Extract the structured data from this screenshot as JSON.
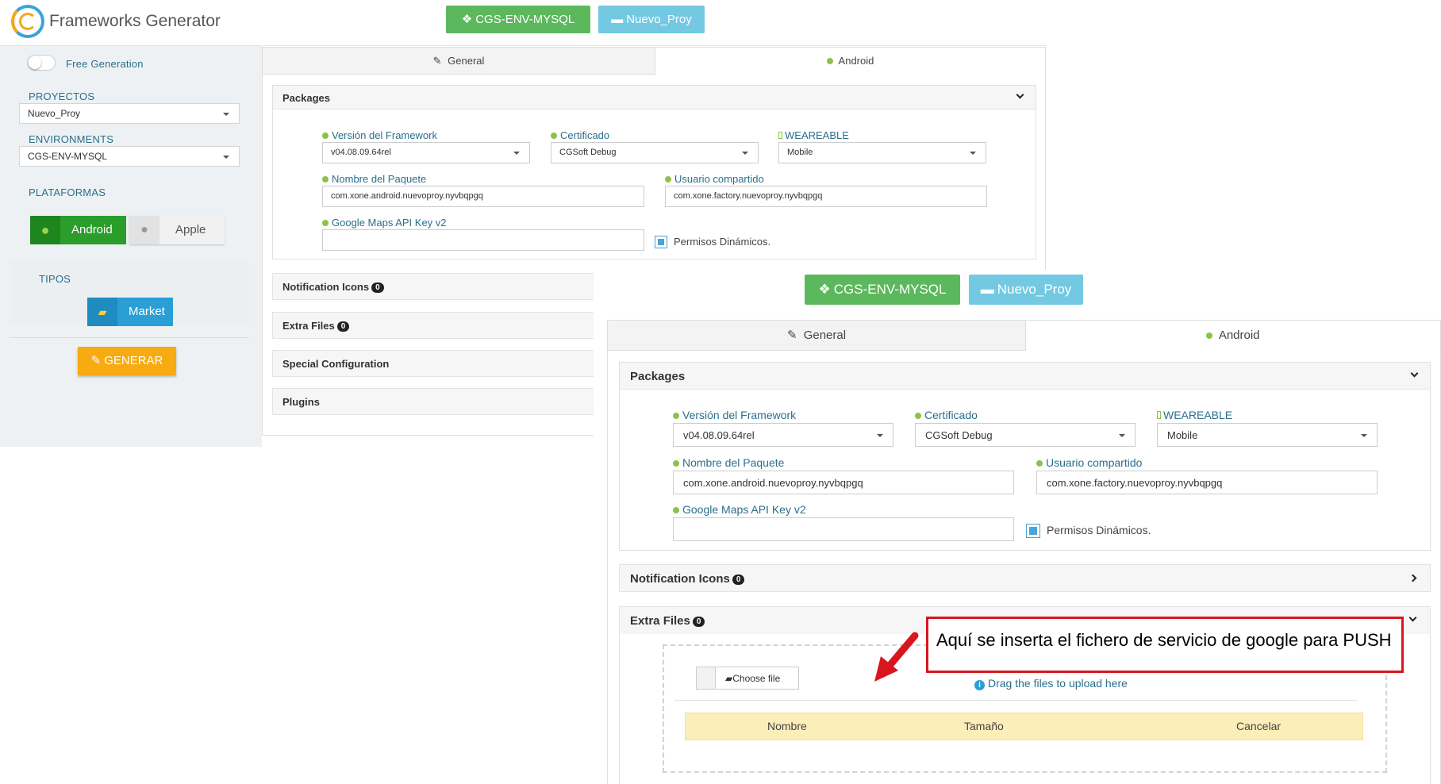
{
  "app": {
    "title": "Frameworks Generator"
  },
  "header": {
    "env_button": "CGS-ENV-MYSQL",
    "project_button": "Nuevo_Proy"
  },
  "sidebar": {
    "free_generation_label": "Free Generation",
    "projects_label": "PROYECTOS",
    "project_value": "Nuevo_Proy",
    "environments_label": "ENVIRONMENTS",
    "environment_value": "CGS-ENV-MYSQL",
    "platforms_label": "PLATAFORMAS",
    "platforms": [
      "Android",
      "Apple"
    ],
    "types_label": "TIPOS",
    "type_button": "Market",
    "generate_button": "GENERAR"
  },
  "tabs": [
    "General",
    "Android"
  ],
  "packages": {
    "title": "Packages",
    "framework_version_label": "Versión del Framework",
    "framework_version_value": "v04.08.09.64rel",
    "certificate_label": "Certificado",
    "certificate_value": "CGSoft Debug",
    "wearable_label": "WEAREABLE",
    "wearable_value": "Mobile",
    "package_name_label": "Nombre del Paquete",
    "package_name_value": "com.xone.android.nuevoproy.nyvbqpgq",
    "shared_user_label": "Usuario compartido",
    "shared_user_value": "com.xone.factory.nuevoproy.nyvbqpgq",
    "maps_key_label": "Google Maps API Key v2",
    "maps_key_value": "",
    "dynamic_permissions_label": "Permisos Dinámicos.",
    "dynamic_permissions_checked": true
  },
  "sections": {
    "notification_icons": "Notification Icons",
    "notification_icons_count": "0",
    "extra_files": "Extra Files",
    "extra_files_count": "0",
    "special_configuration": "Special Configuration",
    "plugins": "Plugins"
  },
  "upload": {
    "choose_file": "Choose file",
    "drag_hint": "Drag the files to upload here",
    "columns": [
      "Nombre",
      "Tamaño",
      "Cancelar"
    ]
  },
  "annotation": {
    "text": "Aquí se inserta el fichero de servicio de google para PUSH"
  },
  "colors": {
    "green": "#5cb85c",
    "blue": "#5bc0de",
    "orange": "#f6ab12",
    "red": "#d9161f"
  },
  "icons": [
    "logo-icon",
    "cubes-icon",
    "briefcase-icon",
    "edit-icon",
    "android-icon",
    "apple-icon",
    "cart-icon",
    "wand-icon",
    "box-icon",
    "user-icon",
    "map-marker-icon",
    "mobile-icon",
    "folder-open-icon",
    "info-icon",
    "chevron-down-icon",
    "chevron-right-icon"
  ]
}
